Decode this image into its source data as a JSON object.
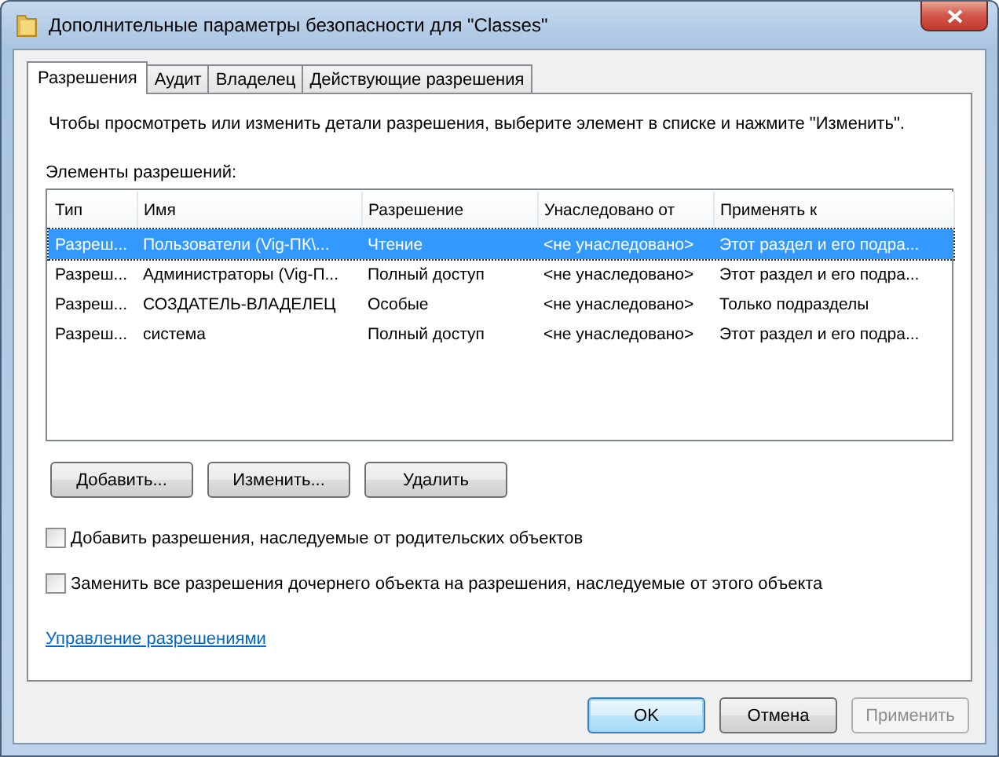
{
  "window": {
    "title": "Дополнительные параметры безопасности  для \"Classes\""
  },
  "tabs": [
    {
      "label": "Разрешения",
      "selected": true
    },
    {
      "label": "Аудит",
      "selected": false
    },
    {
      "label": "Владелец",
      "selected": false
    },
    {
      "label": "Действующие разрешения",
      "selected": false
    }
  ],
  "instruction": "Чтобы просмотреть или изменить детали разрешения, выберите элемент в списке и нажмите \"Изменить\".",
  "list_label": "Элементы разрешений:",
  "table": {
    "columns": [
      "Тип",
      "Имя",
      "Разрешение",
      "Унаследовано от",
      "Применять к"
    ],
    "rows": [
      {
        "cells": [
          "Разреш...",
          "Пользователи (Vig-ПК\\...",
          "Чтение",
          "<не унаследовано>",
          "Этот раздел и его подра..."
        ],
        "selected": true
      },
      {
        "cells": [
          "Разреш...",
          "Администраторы (Vig-П...",
          "Полный доступ",
          "<не унаследовано>",
          "Этот раздел и его подра..."
        ],
        "selected": false
      },
      {
        "cells": [
          "Разреш...",
          "СОЗДАТЕЛЬ-ВЛАДЕЛЕЦ",
          "Особые",
          "<не унаследовано>",
          "Только подразделы"
        ],
        "selected": false
      },
      {
        "cells": [
          "Разреш...",
          "система",
          "Полный доступ",
          "<не унаследовано>",
          "Этот раздел и его подра..."
        ],
        "selected": false
      }
    ]
  },
  "list_buttons": [
    "Добавить...",
    "Изменить...",
    "Удалить"
  ],
  "checkboxes": [
    {
      "label": "Добавить разрешения, наследуемые от родительских объектов",
      "checked": false
    },
    {
      "label": "Заменить все разрешения дочернего объекта на разрешения, наследуемые от этого объекта",
      "checked": false
    }
  ],
  "link": "Управление разрешениями",
  "dialog_buttons": [
    {
      "label": "OK",
      "default": true,
      "disabled": false
    },
    {
      "label": "Отмена",
      "default": false,
      "disabled": false
    },
    {
      "label": "Применить",
      "default": false,
      "disabled": true
    }
  ]
}
